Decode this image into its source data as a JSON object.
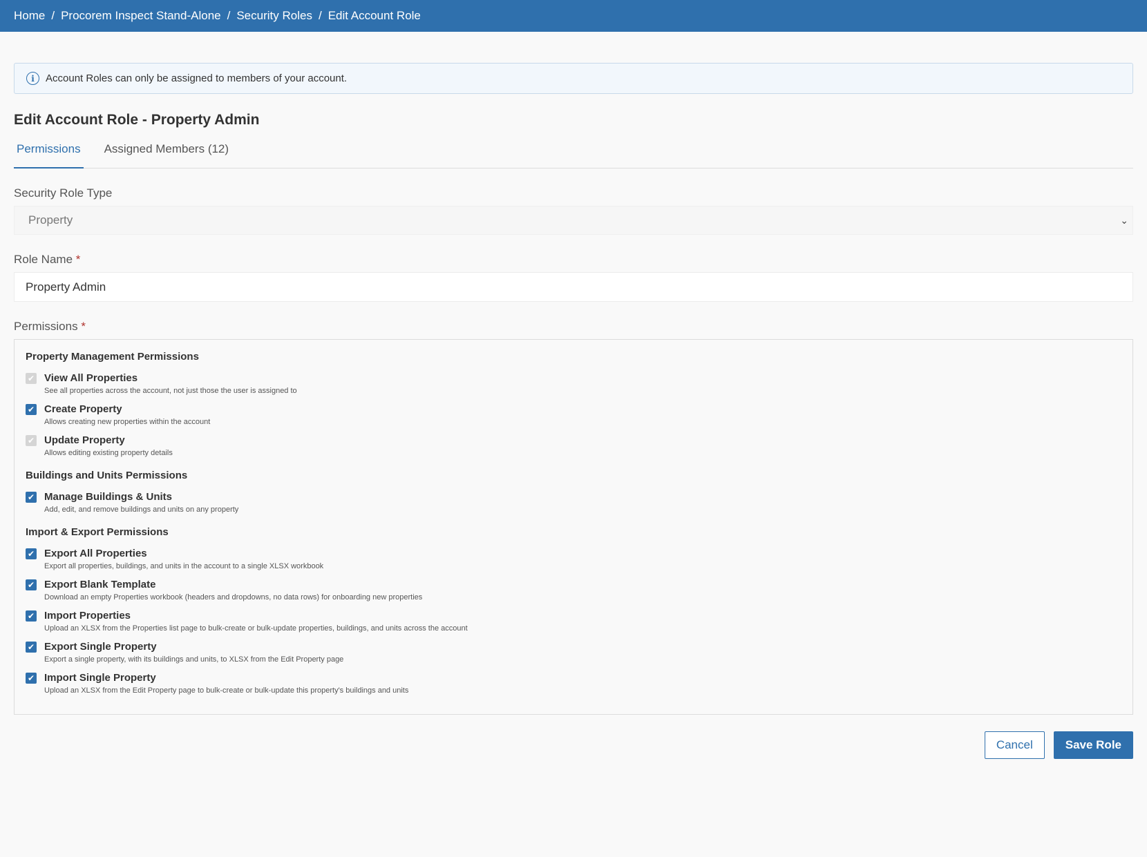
{
  "breadcrumb": [
    "Home",
    "Procorem Inspect Stand-Alone",
    "Security Roles",
    "Edit Account Role"
  ],
  "breadcrumb_sep": "/",
  "alert": {
    "text": "Account Roles can only be assigned to members of your account.",
    "icon": "info-icon"
  },
  "page_title": "Edit Account Role - Property Admin",
  "tabs": [
    {
      "label": "Permissions",
      "active": true
    },
    {
      "label": "Assigned Members (12)",
      "active": false
    }
  ],
  "security_role_type": {
    "label": "Security Role Type",
    "value": "Property"
  },
  "role_name": {
    "label": "Role Name",
    "required": "*",
    "value": "Property Admin"
  },
  "permissions_label": "Permissions",
  "permissions_required": "*",
  "groups": [
    {
      "title": "Property Management Permissions",
      "items": [
        {
          "name": "View All Properties",
          "desc": "See all properties across the account, not just those the user is assigned to",
          "checked": true,
          "disabled": true
        },
        {
          "name": "Create Property",
          "desc": "Allows creating new properties within the account",
          "checked": true,
          "disabled": false
        },
        {
          "name": "Update Property",
          "desc": "Allows editing existing property details",
          "checked": true,
          "disabled": true
        }
      ]
    },
    {
      "title": "Buildings and Units Permissions",
      "items": [
        {
          "name": "Manage Buildings & Units",
          "desc": "Add, edit, and remove buildings and units on any property",
          "checked": true,
          "disabled": false
        }
      ]
    },
    {
      "title": "Import & Export Permissions",
      "items": [
        {
          "name": "Export All Properties",
          "desc": "Export all properties, buildings, and units in the account to a single XLSX workbook",
          "checked": true,
          "disabled": false
        },
        {
          "name": "Export Blank Template",
          "desc": "Download an empty Properties workbook (headers and dropdowns, no data rows) for onboarding new properties",
          "checked": true,
          "disabled": false
        },
        {
          "name": "Import Properties",
          "desc": "Upload an XLSX from the Properties list page to bulk-create or bulk-update properties, buildings, and units across the account",
          "checked": true,
          "disabled": false
        },
        {
          "name": "Export Single Property",
          "desc": "Export a single property, with its buildings and units, to XLSX from the Edit Property page",
          "checked": true,
          "disabled": false
        },
        {
          "name": "Import Single Property",
          "desc": "Upload an XLSX from the Edit Property page to bulk-create or bulk-update this property's buildings and units",
          "checked": true,
          "disabled": false
        }
      ]
    }
  ],
  "actions": {
    "cancel": "Cancel",
    "save": "Save Role"
  }
}
